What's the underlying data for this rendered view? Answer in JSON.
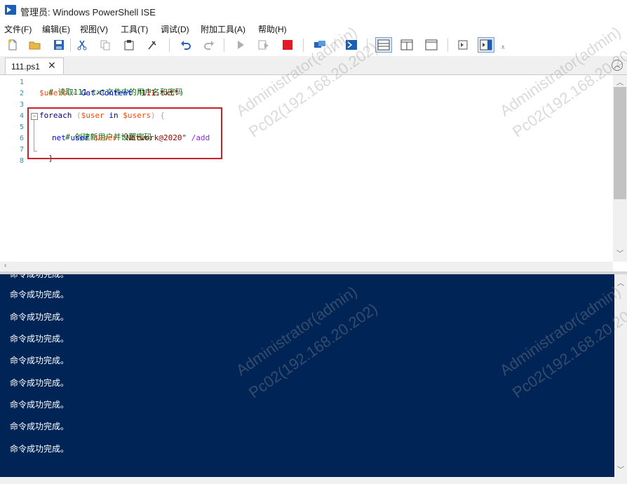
{
  "window": {
    "title": "管理员: Windows PowerShell ISE"
  },
  "menu": [
    "文件(F)",
    "编辑(E)",
    "视图(V)",
    "工具(T)",
    "调试(D)",
    "附加工具(A)",
    "帮助(H)"
  ],
  "toolbar": {
    "icons": [
      "new-icon",
      "open-icon",
      "save-icon",
      "cut-icon",
      "copy-icon",
      "paste-icon",
      "clear-icon",
      "undo-icon",
      "redo-icon",
      "run-icon",
      "run-selection-icon",
      "stop-icon",
      "remote-icon",
      "powershell-icon",
      "layout-top-icon",
      "layout-right-icon",
      "layout-max-icon",
      "show-script-icon",
      "show-commands-icon"
    ],
    "overflow": "⩡"
  },
  "tab": {
    "label": "111.ps1",
    "close": "✕"
  },
  "editor": {
    "line_numbers": [
      "1",
      "2",
      "3",
      "4",
      "5",
      "6",
      "7",
      "8"
    ],
    "lines": {
      "l1": "# 读取111.txt文件中的用户名和密码",
      "l2_var": "$users",
      "l2_eq": " = ",
      "l2_cmd": "Get-Content",
      "l2_str": " \"111.txt\"",
      "l4_kw": "foreach",
      "l4_rest1": " (",
      "l4_var1": "$user",
      "l4_in": " in ",
      "l4_var2": "$users",
      "l4_rest2": ") {",
      "l5": "# 创建新用户并设置密码",
      "l6_cmd": "net user ",
      "l6_var": "$user",
      "l6_str": " \"Network@2020\"",
      "l6_param": " /add",
      "l7": "}"
    },
    "fold_symbol": "−"
  },
  "console": {
    "top_partial": "命令成功完成。",
    "lines": [
      "命令成功完成。",
      "命令成功完成。",
      "命令成功完成。",
      "命令成功完成。",
      "命令成功完成。",
      "命令成功完成。",
      "命令成功完成。",
      "命令成功完成。"
    ]
  },
  "watermark": {
    "user": "Administrator(admin)",
    "host": "Pc02(192.168.20.202)"
  },
  "colors": {
    "console_bg": "#012456",
    "highlight_border": "#c8232c",
    "comment": "#006400",
    "variable": "#ff4500",
    "command": "#0000ff",
    "string": "#8b0000"
  }
}
